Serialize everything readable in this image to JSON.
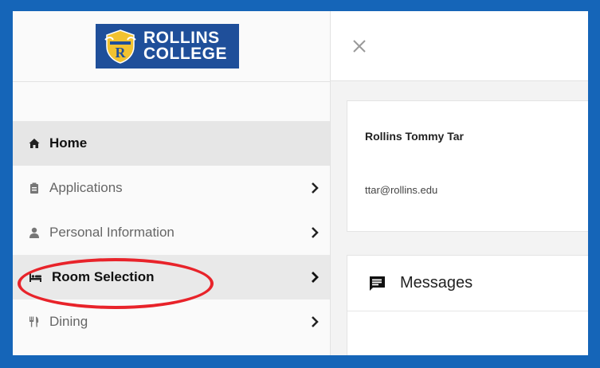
{
  "logo": {
    "line1": "ROLLINS",
    "line2": "COLLEGE"
  },
  "nav": {
    "items": [
      {
        "label": "Home",
        "icon": "home-icon"
      },
      {
        "label": "Applications",
        "icon": "clipboard-icon"
      },
      {
        "label": "Personal Information",
        "icon": "person-icon"
      },
      {
        "label": "Room Selection",
        "icon": "bed-icon"
      },
      {
        "label": "Dining",
        "icon": "utensils-icon"
      }
    ]
  },
  "profile": {
    "name": "Rollins Tommy Tar",
    "email": "ttar@rollins.edu"
  },
  "messages": {
    "title": "Messages"
  },
  "colors": {
    "brand": "#1f4f9a",
    "frame": "#1565b8",
    "annotation": "#e8232a"
  }
}
